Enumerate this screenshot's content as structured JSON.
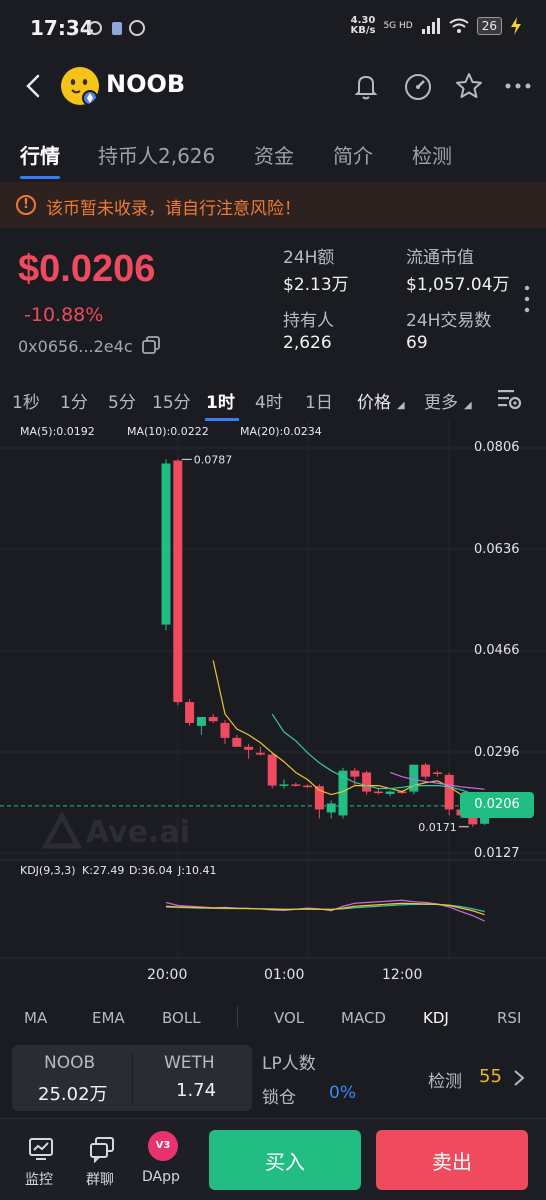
{
  "status_bar": {
    "time": "17:34",
    "net_speed": "4.30",
    "net_unit": "KB/s",
    "network": "5G HD",
    "battery": "26"
  },
  "header": {
    "token_name": "NOOB",
    "icons": [
      "back-icon",
      "bell-icon",
      "gauge-icon",
      "star-icon",
      "more-icon"
    ]
  },
  "tabs": [
    {
      "label": "行情",
      "active": true
    },
    {
      "label": "持币人2,626",
      "active": false
    },
    {
      "label": "资金",
      "active": false
    },
    {
      "label": "简介",
      "active": false
    },
    {
      "label": "检测",
      "active": false
    }
  ],
  "warning": {
    "icon": "!",
    "text": "该币暂未收录，请自行注意风险！"
  },
  "summary": {
    "price": "$0.0206",
    "change": "-10.88%",
    "address": "0x0656...2e4c",
    "stats": [
      {
        "label": "24H额",
        "value": "$2.13万"
      },
      {
        "label": "流通市值",
        "value": "$1,057.04万"
      },
      {
        "label": "持有人",
        "value": "2,626"
      },
      {
        "label": "24H交易数",
        "value": "69"
      }
    ]
  },
  "intervals": [
    {
      "label": "1秒",
      "active": false
    },
    {
      "label": "1分",
      "active": false
    },
    {
      "label": "5分",
      "active": false
    },
    {
      "label": "15分",
      "active": false
    },
    {
      "label": "1时",
      "active": true
    },
    {
      "label": "4时",
      "active": false
    },
    {
      "label": "1日",
      "active": false
    }
  ],
  "chart_controls": {
    "price_label": "价格",
    "more_label": "更多"
  },
  "colors": {
    "up": "#22bd83",
    "down": "#ef4a5e",
    "ma5": "#f1c232",
    "ma10": "#35c7a1",
    "ma20": "#c86be0",
    "accent": "#3a7bf6"
  },
  "chart_data": {
    "type": "candlestick",
    "ma_legend": [
      {
        "label": "MA(5):0.0192",
        "color": "#f1c232"
      },
      {
        "label": "MA(10):0.0222",
        "color": "#35c7a1"
      },
      {
        "label": "MA(20):0.0234",
        "color": "#c86be0"
      }
    ],
    "y_ticks": [
      "0.0806",
      "0.0636",
      "0.0466",
      "0.0296",
      "0.0127"
    ],
    "ylim": [
      0.0127,
      0.0806
    ],
    "current_price": "0.0206",
    "current_value": 0.0206,
    "high_label": "0.0787",
    "high_value": 0.0787,
    "low_label": "0.0171",
    "low_value": 0.0171,
    "x_ticks": [
      "20:00",
      "01:00",
      "12:00"
    ],
    "x_tick_index": [
      1,
      12,
      24
    ],
    "candles": [
      {
        "o": 0.051,
        "h": 0.0787,
        "l": 0.05,
        "c": 0.078
      },
      {
        "o": 0.0785,
        "h": 0.0787,
        "l": 0.0375,
        "c": 0.038
      },
      {
        "o": 0.038,
        "h": 0.0385,
        "l": 0.034,
        "c": 0.0345
      },
      {
        "o": 0.034,
        "h": 0.0355,
        "l": 0.0325,
        "c": 0.0355
      },
      {
        "o": 0.0355,
        "h": 0.036,
        "l": 0.0345,
        "c": 0.0348
      },
      {
        "o": 0.0345,
        "h": 0.035,
        "l": 0.031,
        "c": 0.032
      },
      {
        "o": 0.032,
        "h": 0.0325,
        "l": 0.0305,
        "c": 0.0305
      },
      {
        "o": 0.0305,
        "h": 0.031,
        "l": 0.0285,
        "c": 0.03
      },
      {
        "o": 0.0295,
        "h": 0.0305,
        "l": 0.029,
        "c": 0.0292
      },
      {
        "o": 0.0292,
        "h": 0.0295,
        "l": 0.0235,
        "c": 0.024
      },
      {
        "o": 0.024,
        "h": 0.025,
        "l": 0.0235,
        "c": 0.0242
      },
      {
        "o": 0.0242,
        "h": 0.0245,
        "l": 0.0238,
        "c": 0.024
      },
      {
        "o": 0.024,
        "h": 0.0242,
        "l": 0.0236,
        "c": 0.0239
      },
      {
        "o": 0.0239,
        "h": 0.0242,
        "l": 0.0185,
        "c": 0.02
      },
      {
        "o": 0.0195,
        "h": 0.0215,
        "l": 0.0185,
        "c": 0.021
      },
      {
        "o": 0.019,
        "h": 0.027,
        "l": 0.0185,
        "c": 0.0265
      },
      {
        "o": 0.0265,
        "h": 0.027,
        "l": 0.024,
        "c": 0.0255
      },
      {
        "o": 0.0262,
        "h": 0.0265,
        "l": 0.0225,
        "c": 0.023
      },
      {
        "o": 0.023,
        "h": 0.0235,
        "l": 0.0225,
        "c": 0.0228
      },
      {
        "o": 0.0226,
        "h": 0.0232,
        "l": 0.0222,
        "c": 0.023
      },
      {
        "o": 0.023,
        "h": 0.0232,
        "l": 0.0226,
        "c": 0.0228
      },
      {
        "o": 0.023,
        "h": 0.0275,
        "l": 0.0225,
        "c": 0.0275
      },
      {
        "o": 0.0275,
        "h": 0.0278,
        "l": 0.025,
        "c": 0.0255
      },
      {
        "o": 0.0262,
        "h": 0.0265,
        "l": 0.0255,
        "c": 0.026
      },
      {
        "o": 0.0258,
        "h": 0.0262,
        "l": 0.019,
        "c": 0.02
      },
      {
        "o": 0.02,
        "h": 0.0205,
        "l": 0.0185,
        "c": 0.019
      },
      {
        "o": 0.0195,
        "h": 0.02,
        "l": 0.0171,
        "c": 0.0175
      },
      {
        "o": 0.0176,
        "h": 0.0216,
        "l": 0.0174,
        "c": 0.0215
      }
    ],
    "ma5": [
      null,
      null,
      null,
      null,
      0.045,
      0.036,
      0.0335,
      0.0325,
      0.0312,
      0.0295,
      0.028,
      0.0262,
      0.025,
      0.0232,
      0.0225,
      0.023,
      0.024,
      0.024,
      0.024,
      0.0235,
      0.023,
      0.024,
      0.0245,
      0.0248,
      0.0238,
      0.0225,
      0.0205,
      0.0192
    ],
    "ma10": [
      null,
      null,
      null,
      null,
      null,
      null,
      null,
      null,
      null,
      0.036,
      0.033,
      0.0315,
      0.0295,
      0.0278,
      0.0265,
      0.0255,
      0.0245,
      0.024,
      0.0235,
      0.0235,
      0.0237,
      0.024,
      0.024,
      0.024,
      0.0238,
      0.0233,
      0.0226,
      0.0222
    ],
    "ma20": [
      null,
      null,
      null,
      null,
      null,
      null,
      null,
      null,
      null,
      null,
      null,
      null,
      null,
      null,
      null,
      null,
      null,
      null,
      null,
      0.0262,
      0.0255,
      0.025,
      0.0247,
      0.0244,
      0.0241,
      0.0238,
      0.0236,
      0.0234
    ],
    "kdj_legend": [
      {
        "label": "KDJ(9,3,3)",
        "color": "#e2e3e8"
      },
      {
        "label": "K:27.49",
        "color": "#f1c232"
      },
      {
        "label": "D:36.04",
        "color": "#35c7a1"
      },
      {
        "label": "J:10.41",
        "color": "#c86be0"
      }
    ],
    "kdj_k": [
      50,
      48,
      47,
      46,
      45,
      45,
      44,
      44,
      43,
      42,
      41,
      42,
      43,
      42,
      41,
      45,
      50,
      52,
      54,
      56,
      58,
      57,
      56,
      55,
      52,
      45,
      38,
      27.49
    ],
    "kdj_d": [
      48,
      47,
      46,
      45,
      45,
      44,
      44,
      44,
      43,
      43,
      42,
      42,
      42,
      42,
      42,
      43,
      46,
      48,
      50,
      52,
      54,
      55,
      55,
      55,
      53,
      49,
      43,
      36.04
    ],
    "kdj_j": [
      60,
      52,
      50,
      48,
      46,
      47,
      45,
      44,
      43,
      40,
      39,
      42,
      45,
      43,
      38,
      50,
      58,
      60,
      62,
      64,
      66,
      62,
      60,
      56,
      48,
      36,
      25,
      10.41
    ]
  },
  "watermark": "Ave.ai",
  "indicators": [
    {
      "label": "MA",
      "active": false
    },
    {
      "label": "EMA",
      "active": false
    },
    {
      "label": "BOLL",
      "active": false
    },
    {
      "label": "VOL",
      "active": false
    },
    {
      "label": "MACD",
      "active": false
    },
    {
      "label": "KDJ",
      "active": true
    },
    {
      "label": "RSI",
      "active": false
    }
  ],
  "liquidity": {
    "token_a_label": "NOOB",
    "token_a_value": "25.02万",
    "token_b_label": "WETH",
    "token_b_value": "1.74",
    "lp_label": "LP人数",
    "lock_label": "锁仓",
    "lock_value": "0%",
    "check_label": "检测",
    "check_score": "55"
  },
  "bottom_nav": {
    "monitor": "监控",
    "group_chat": "群聊",
    "dapp": "DApp",
    "dapp_badge": "V3",
    "buy": "买入",
    "sell": "卖出"
  }
}
